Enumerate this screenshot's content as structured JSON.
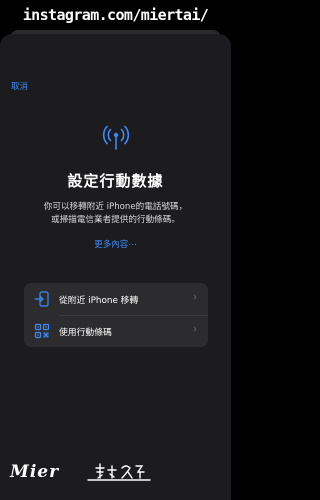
{
  "watermark": {
    "text": "instagram.com/miertai/"
  },
  "sheet": {
    "cancel_label": "取消",
    "title": "設定行動數據",
    "description_line1": "你可以移轉附近 iPhone的電話號碼，",
    "description_line2": "或掃描電信業者提供的行動條碼。",
    "more_link": "更多內容⋯",
    "options": [
      {
        "label": "從附近 iPhone 移轉",
        "icon": "phone-transfer-icon"
      },
      {
        "label": "使用行動條碼",
        "icon": "qr-code-icon"
      }
    ]
  },
  "signature": {
    "text": "Mier"
  },
  "colors": {
    "accent": "#3d8af7",
    "sheet_bg": "#1c1c1e",
    "option_bg": "#2c2c2e"
  }
}
